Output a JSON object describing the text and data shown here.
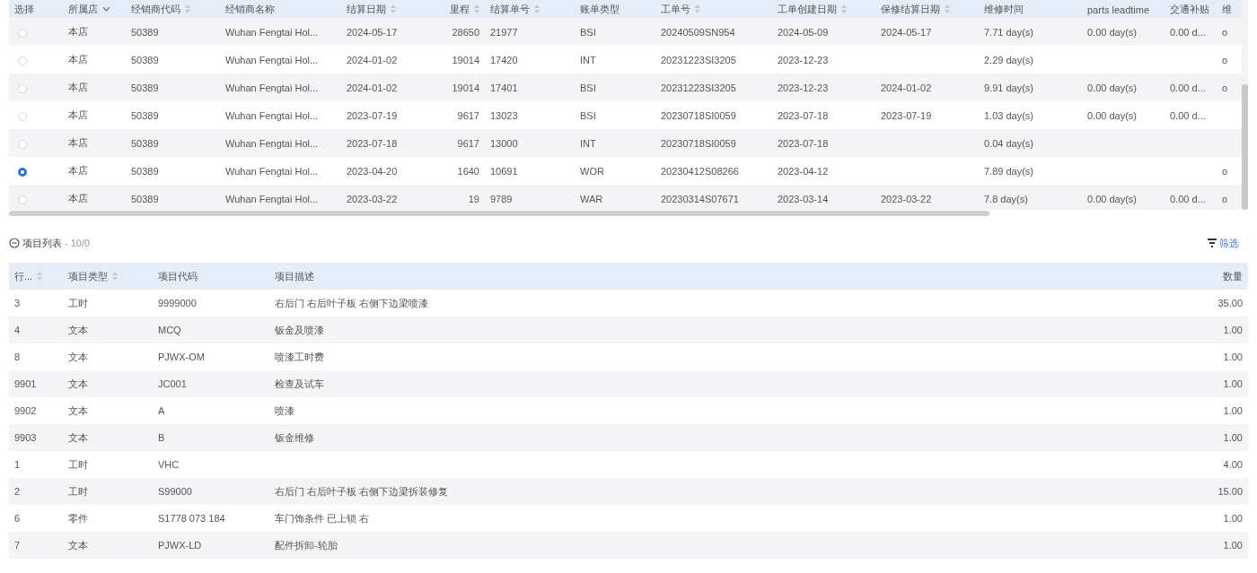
{
  "settlement_table": {
    "select_column_label": "选择",
    "columns": [
      {
        "label": "所属店",
        "kind": "filter"
      },
      {
        "label": "经销商代码",
        "kind": "sort"
      },
      {
        "label": "经销商名称",
        "kind": "plain"
      },
      {
        "label": "结算日期",
        "kind": "sort"
      },
      {
        "label": "里程",
        "kind": "sort",
        "numeric": true
      },
      {
        "label": "结算单号",
        "kind": "sort"
      },
      {
        "label": "账单类型",
        "kind": "plain"
      },
      {
        "label": "工单号",
        "kind": "sort"
      },
      {
        "label": "工单创建日期",
        "kind": "sort"
      },
      {
        "label": "保修结算日期",
        "kind": "sort"
      },
      {
        "label": "维修时间",
        "kind": "plain"
      },
      {
        "label": "parts leadtime",
        "kind": "plain"
      },
      {
        "label": "交通补贴",
        "kind": "plain"
      },
      {
        "label": "维",
        "kind": "plain"
      }
    ],
    "rows": [
      {
        "selected": false,
        "cells": [
          "本店",
          "50389",
          "Wuhan Fengtai Hol...",
          "2024-05-17",
          "28650",
          "21977",
          "BSI",
          "20240509SN954",
          "2024-05-09",
          "2024-05-17",
          "7.71 day(s)",
          "0.00 day(s)",
          "0.00 d...",
          "o"
        ]
      },
      {
        "selected": false,
        "cells": [
          "本店",
          "50389",
          "Wuhan Fengtai Hol...",
          "2024-01-02",
          "19014",
          "17420",
          "INT",
          "20231223SI3205",
          "2023-12-23",
          "",
          "2.29 day(s)",
          "",
          "",
          "o"
        ]
      },
      {
        "selected": false,
        "cells": [
          "本店",
          "50389",
          "Wuhan Fengtai Hol...",
          "2024-01-02",
          "19014",
          "17401",
          "BSI",
          "20231223SI3205",
          "2023-12-23",
          "2024-01-02",
          "9.91 day(s)",
          "0.00 day(s)",
          "0.00 d...",
          "o"
        ]
      },
      {
        "selected": false,
        "cells": [
          "本店",
          "50389",
          "Wuhan Fengtai Hol...",
          "2023-07-19",
          "9617",
          "13023",
          "BSI",
          "20230718SI0059",
          "2023-07-18",
          "2023-07-19",
          "1.03 day(s)",
          "0.00 day(s)",
          "0.00 d...",
          ""
        ]
      },
      {
        "selected": false,
        "cells": [
          "本店",
          "50389",
          "Wuhan Fengtai Hol...",
          "2023-07-18",
          "9617",
          "13000",
          "INT",
          "20230718SI0059",
          "2023-07-18",
          "",
          "0.04 day(s)",
          "",
          "",
          ""
        ]
      },
      {
        "selected": true,
        "cells": [
          "本店",
          "50389",
          "Wuhan Fengtai Hol...",
          "2023-04-20",
          "1640",
          "10691",
          "WOR",
          "20230412S08266",
          "2023-04-12",
          "",
          "7.89 day(s)",
          "",
          "",
          "o"
        ]
      },
      {
        "selected": false,
        "cells": [
          "本店",
          "50389",
          "Wuhan Fengtai Hol...",
          "2023-03-22",
          "19",
          "9789",
          "WAR",
          "20230314S07671",
          "2023-03-14",
          "2023-03-22",
          "7.8 day(s)",
          "0.00 day(s)",
          "0.00 d...",
          "o"
        ]
      }
    ]
  },
  "items_section": {
    "title": "项目列表",
    "count": "- 10/0",
    "filter_link": "筛选",
    "columns": [
      {
        "label": "行...",
        "kind": "sort"
      },
      {
        "label": "项目类型",
        "kind": "sort"
      },
      {
        "label": "项目代码",
        "kind": "plain"
      },
      {
        "label": "项目描述",
        "kind": "plain"
      },
      {
        "label": "数量",
        "kind": "plain",
        "numeric": true
      }
    ],
    "rows": [
      [
        "3",
        "工时",
        "9999000",
        "右后门 右后叶子板 右侧下边梁喷漆",
        "35.00"
      ],
      [
        "4",
        "文本",
        "MCQ",
        "钣金及喷漆",
        "1.00"
      ],
      [
        "8",
        "文本",
        "PJWX-OM",
        "喷漆工时费",
        "1.00"
      ],
      [
        "9901",
        "文本",
        "JC001",
        "检查及试车",
        "1.00"
      ],
      [
        "9902",
        "文本",
        "A",
        "喷漆",
        "1.00"
      ],
      [
        "9903",
        "文本",
        "B",
        "钣金维修",
        "1.00"
      ],
      [
        "1",
        "工时",
        "VHC",
        "",
        "4.00"
      ],
      [
        "2",
        "工时",
        "S99000",
        "右后门 右后叶子板 右侧下边梁拆装修复",
        "15.00"
      ],
      [
        "6",
        "零件",
        "S1778 073 184",
        "车门饰条件 已上锁 右",
        "1.00"
      ],
      [
        "7",
        "文本",
        "PJWX-LD",
        "配件拆卸-轮胎",
        "1.00"
      ]
    ]
  }
}
